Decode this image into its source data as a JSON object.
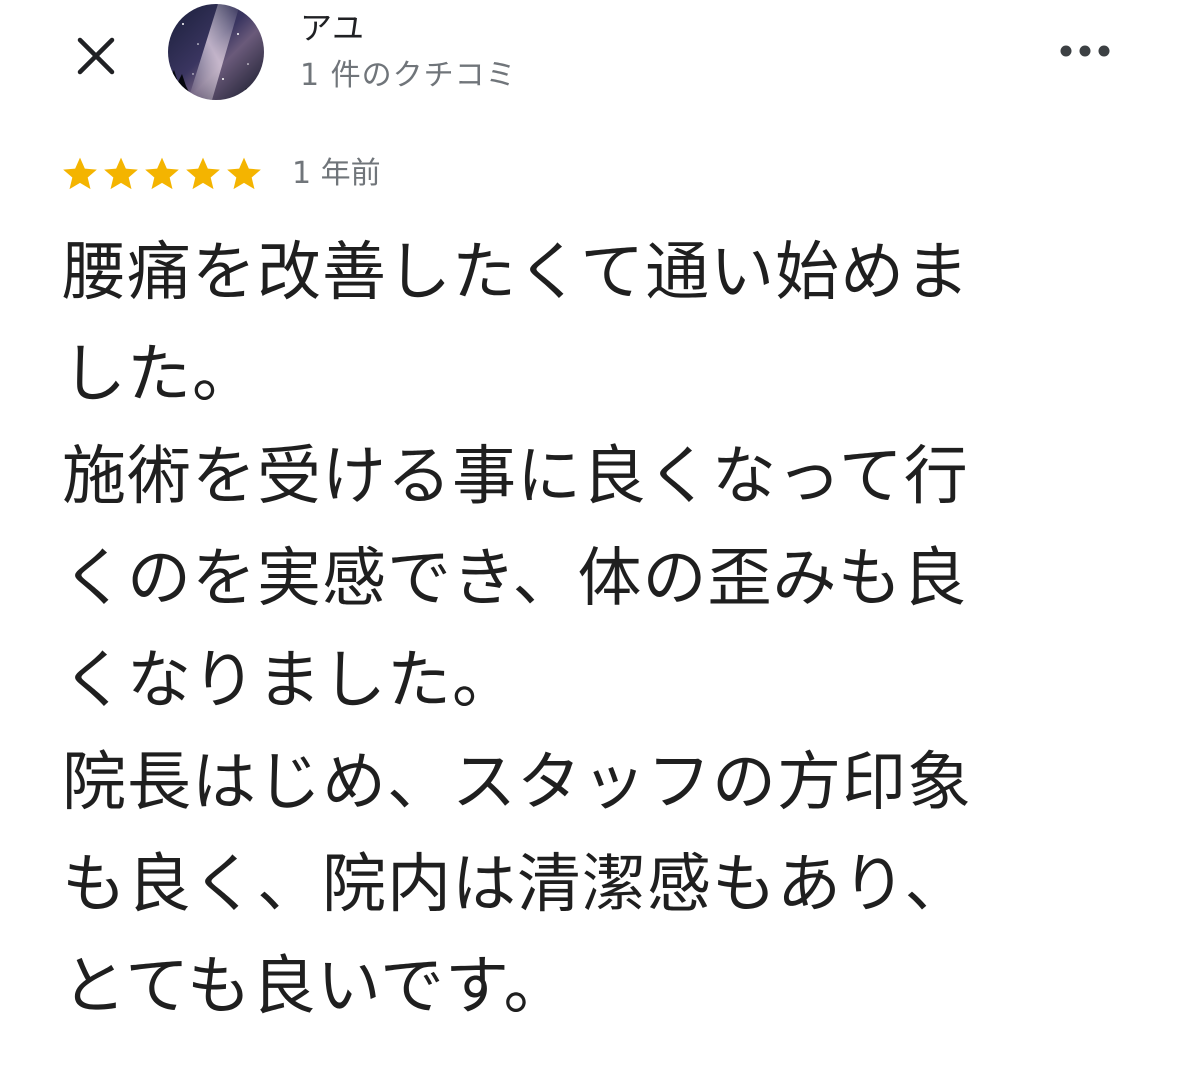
{
  "header": {
    "close_icon": "close-icon",
    "more_icon": "more-horizontal-icon",
    "user": {
      "name": "アユ",
      "review_count": "1 件のクチコミ",
      "avatar": "starry-night-avatar"
    }
  },
  "rating": {
    "stars": 5,
    "max_stars": 5,
    "star_color": "#f4b400",
    "time_ago": "1 年前"
  },
  "review": {
    "lines": [
      "腰痛を改善したくて通い始めま",
      "した。",
      "施術を受ける事に良くなって行",
      "くのを実感でき、体の歪みも良",
      "くなりました。",
      "院長はじめ、スタッフの方印象",
      "も良く、院内は清潔感もあり、",
      "とても良いです。"
    ]
  }
}
